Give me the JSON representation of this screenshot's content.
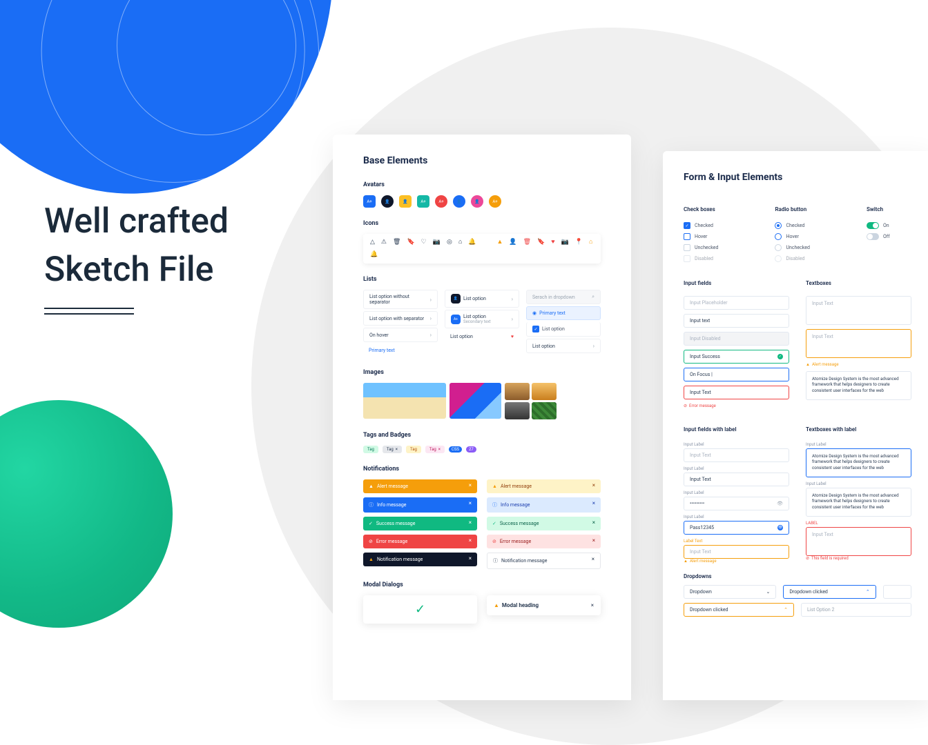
{
  "headline": {
    "line1": "Well crafted",
    "line2": "Sketch File"
  },
  "colors": {
    "blue": "#1A6DF5",
    "green": "#10B981",
    "teal": "#14B8A6",
    "orange": "#F59E0B",
    "red": "#EF4444",
    "navy": "#0F172A",
    "cyan": "#0EA5E9",
    "pink": "#EC4899",
    "purple": "#8B5CF6"
  },
  "base": {
    "title": "Base Elements",
    "avatars_heading": "Avatars",
    "avatars": [
      {
        "bg": "#1A6DF5",
        "label": "A+",
        "shape": "sq"
      },
      {
        "bg": "#0F172A",
        "label": "👤",
        "shape": "round"
      },
      {
        "bg": "#FBBF24",
        "label": "👤",
        "shape": "sq"
      },
      {
        "bg": "#14B8A6",
        "label": "A+",
        "shape": "sq"
      },
      {
        "bg": "#EF4444",
        "label": "A+",
        "shape": "round"
      },
      {
        "bg": "#1A6DF5",
        "label": "👤",
        "shape": "round"
      },
      {
        "bg": "#EC4899",
        "label": "👤",
        "shape": "round"
      },
      {
        "bg": "#F59E0B",
        "label": "A+",
        "shape": "round"
      }
    ],
    "icons_heading": "Icons",
    "icon_row1": [
      "△",
      "⚠",
      "🗑",
      "🔖",
      "♡",
      "📷",
      "◎",
      "⌂",
      "🔔"
    ],
    "icon_row2": [
      {
        "g": "▲",
        "c": "#F59E0B"
      },
      {
        "g": "👤",
        "c": "#1A6DF5"
      },
      {
        "g": "🗑",
        "c": "#EF4444"
      },
      {
        "g": "🔖",
        "c": "#10B981"
      },
      {
        "g": "♥",
        "c": "#EF4444"
      },
      {
        "g": "📷",
        "c": "#1A6DF5"
      },
      {
        "g": "📍",
        "c": "#EF4444"
      },
      {
        "g": "⌂",
        "c": "#F59E0B"
      },
      {
        "g": "🔔",
        "c": "#8B5CF6"
      }
    ],
    "lists_heading": "Lists",
    "lists": {
      "col1": [
        "List option without separator",
        "List option with separator",
        "On hover",
        "Primary text"
      ],
      "col2_item1": "List option",
      "col2_item2_primary": "List option",
      "col2_item2_secondary": "Secondary text",
      "col2_item3": "List option",
      "col3_search": "Serach in dropdown",
      "col3_primary": "Primary text",
      "col3_checked": "List option",
      "col3_plain": "List option"
    },
    "images_heading": "Images",
    "tags_heading": "Tags and Badges",
    "tags": [
      "Tag",
      "Tag",
      "Tag",
      "Tag"
    ],
    "badges": [
      "CSS",
      "27"
    ],
    "notifications_heading": "Notifications",
    "notifs": {
      "alert": "Alert message",
      "info": "Info message",
      "success": "Success message",
      "error": "Error message",
      "notification": "Notification message"
    },
    "modal_heading": "Modal Dialogs",
    "modal": {
      "title": "Modal heading"
    }
  },
  "form": {
    "title": "Form & Input Elements",
    "checkboxes_heading": "Check boxes",
    "radio_heading": "Radio button",
    "switch_heading": "Switch",
    "states": {
      "checked": "Checked",
      "hover": "Hover",
      "unchecked": "Unchecked",
      "disabled": "Disabled",
      "on": "On",
      "off": "Off"
    },
    "input_fields_heading": "Input fields",
    "textboxes_heading": "Textboxes",
    "inputs": {
      "placeholder": "Input Placeholder",
      "text": "Input text",
      "disabled": "Input Disabled",
      "success": "Input Success",
      "focus": "On Focus |",
      "error_val": "Input Text",
      "error_msg": "Error message"
    },
    "textboxes": {
      "placeholder": "Input Text",
      "warn_ph": "Input Text",
      "alert_msg": "Alert message",
      "filled": "Atomize Design System is the most advanced framework that helps designers to create consistent user interfaces for the web"
    },
    "input_label_heading": "Input fields with label",
    "textbox_label_heading": "Textboxes with label",
    "labels": {
      "input_label": "Input Label",
      "label_text": "Label Text",
      "label_caps": "LABEL"
    },
    "input_text_ph": "Input Text",
    "input_text_val": "Input Text",
    "password_dots": "•••••••••",
    "password_show": "Pass12345",
    "alert_msg": "Alert message",
    "field_required": "This field is required",
    "dropdowns_heading": "Dropdowns",
    "dropdown": {
      "closed": "Dropdown",
      "clicked": "Dropdown clicked",
      "clicked2": "Dropdown clicked",
      "option": "List Option 2"
    }
  }
}
